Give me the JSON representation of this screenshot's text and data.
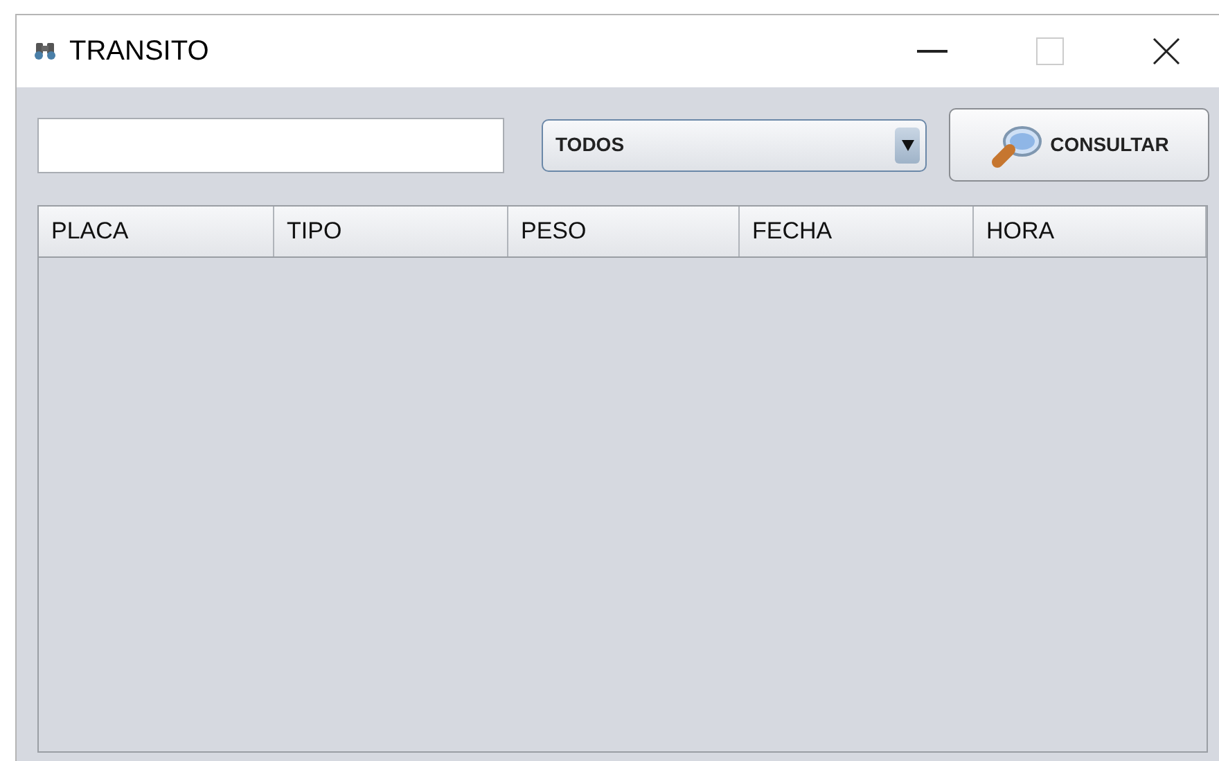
{
  "window": {
    "title": "TRANSITO"
  },
  "filter": {
    "value": "TODOS"
  },
  "consult_button": {
    "label": "CONSULTAR"
  },
  "table": {
    "columns": [
      "PLACA",
      "TIPO",
      "PESO",
      "FECHA",
      "HORA"
    ]
  }
}
